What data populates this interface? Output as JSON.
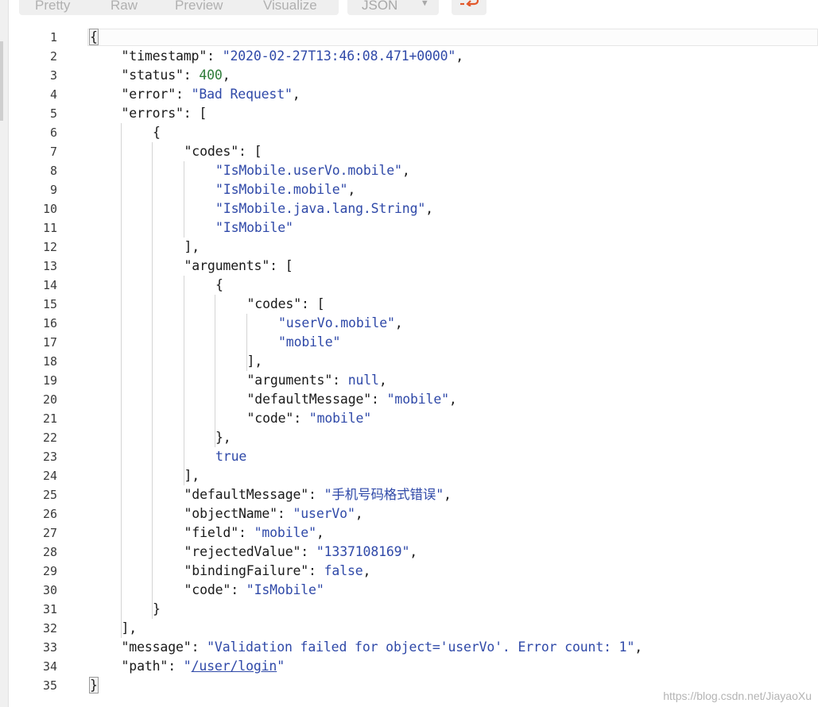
{
  "toolbar": {
    "tabs": [
      "Pretty",
      "Raw",
      "Preview",
      "Visualize"
    ],
    "format": "JSON",
    "icons": {
      "caret": "chevron-down-icon",
      "wrap": "line-wrap-icon"
    },
    "accent": "#e2582b"
  },
  "colors": {
    "string": "#2f49a8",
    "number": "#2f7d3a",
    "key": "#1a1a1a"
  },
  "editor": {
    "lines": [
      {
        "n": "1",
        "indent": 0,
        "tokens": [
          {
            "t": "{",
            "c": "p"
          }
        ]
      },
      {
        "n": "2",
        "indent": 1,
        "tokens": [
          {
            "t": "\"timestamp\"",
            "c": "k"
          },
          {
            "t": ": ",
            "c": "p"
          },
          {
            "t": "\"2020-02-27T13:46:08.471+0000\"",
            "c": "s"
          },
          {
            "t": ",",
            "c": "p"
          }
        ]
      },
      {
        "n": "3",
        "indent": 1,
        "tokens": [
          {
            "t": "\"status\"",
            "c": "k"
          },
          {
            "t": ": ",
            "c": "p"
          },
          {
            "t": "400",
            "c": "n"
          },
          {
            "t": ",",
            "c": "p"
          }
        ]
      },
      {
        "n": "4",
        "indent": 1,
        "tokens": [
          {
            "t": "\"error\"",
            "c": "k"
          },
          {
            "t": ": ",
            "c": "p"
          },
          {
            "t": "\"Bad Request\"",
            "c": "s"
          },
          {
            "t": ",",
            "c": "p"
          }
        ]
      },
      {
        "n": "5",
        "indent": 1,
        "tokens": [
          {
            "t": "\"errors\"",
            "c": "k"
          },
          {
            "t": ": [",
            "c": "p"
          }
        ]
      },
      {
        "n": "6",
        "indent": 2,
        "tokens": [
          {
            "t": "{",
            "c": "p"
          }
        ]
      },
      {
        "n": "7",
        "indent": 3,
        "tokens": [
          {
            "t": "\"codes\"",
            "c": "k"
          },
          {
            "t": ": [",
            "c": "p"
          }
        ]
      },
      {
        "n": "8",
        "indent": 4,
        "tokens": [
          {
            "t": "\"IsMobile.userVo.mobile\"",
            "c": "s"
          },
          {
            "t": ",",
            "c": "p"
          }
        ]
      },
      {
        "n": "9",
        "indent": 4,
        "tokens": [
          {
            "t": "\"IsMobile.mobile\"",
            "c": "s"
          },
          {
            "t": ",",
            "c": "p"
          }
        ]
      },
      {
        "n": "10",
        "indent": 4,
        "tokens": [
          {
            "t": "\"IsMobile.java.lang.String\"",
            "c": "s"
          },
          {
            "t": ",",
            "c": "p"
          }
        ]
      },
      {
        "n": "11",
        "indent": 4,
        "tokens": [
          {
            "t": "\"IsMobile\"",
            "c": "s"
          }
        ]
      },
      {
        "n": "12",
        "indent": 3,
        "tokens": [
          {
            "t": "],",
            "c": "p"
          }
        ]
      },
      {
        "n": "13",
        "indent": 3,
        "tokens": [
          {
            "t": "\"arguments\"",
            "c": "k"
          },
          {
            "t": ": [",
            "c": "p"
          }
        ]
      },
      {
        "n": "14",
        "indent": 4,
        "tokens": [
          {
            "t": "{",
            "c": "p"
          }
        ]
      },
      {
        "n": "15",
        "indent": 5,
        "tokens": [
          {
            "t": "\"codes\"",
            "c": "k"
          },
          {
            "t": ": [",
            "c": "p"
          }
        ]
      },
      {
        "n": "16",
        "indent": 6,
        "tokens": [
          {
            "t": "\"userVo.mobile\"",
            "c": "s"
          },
          {
            "t": ",",
            "c": "p"
          }
        ]
      },
      {
        "n": "17",
        "indent": 6,
        "tokens": [
          {
            "t": "\"mobile\"",
            "c": "s"
          }
        ]
      },
      {
        "n": "18",
        "indent": 5,
        "tokens": [
          {
            "t": "],",
            "c": "p"
          }
        ]
      },
      {
        "n": "19",
        "indent": 5,
        "tokens": [
          {
            "t": "\"arguments\"",
            "c": "k"
          },
          {
            "t": ": ",
            "c": "p"
          },
          {
            "t": "null",
            "c": "b"
          },
          {
            "t": ",",
            "c": "p"
          }
        ]
      },
      {
        "n": "20",
        "indent": 5,
        "tokens": [
          {
            "t": "\"defaultMessage\"",
            "c": "k"
          },
          {
            "t": ": ",
            "c": "p"
          },
          {
            "t": "\"mobile\"",
            "c": "s"
          },
          {
            "t": ",",
            "c": "p"
          }
        ]
      },
      {
        "n": "21",
        "indent": 5,
        "tokens": [
          {
            "t": "\"code\"",
            "c": "k"
          },
          {
            "t": ": ",
            "c": "p"
          },
          {
            "t": "\"mobile\"",
            "c": "s"
          }
        ]
      },
      {
        "n": "22",
        "indent": 4,
        "tokens": [
          {
            "t": "},",
            "c": "p"
          }
        ]
      },
      {
        "n": "23",
        "indent": 4,
        "tokens": [
          {
            "t": "true",
            "c": "b"
          }
        ]
      },
      {
        "n": "24",
        "indent": 3,
        "tokens": [
          {
            "t": "],",
            "c": "p"
          }
        ]
      },
      {
        "n": "25",
        "indent": 3,
        "tokens": [
          {
            "t": "\"defaultMessage\"",
            "c": "k"
          },
          {
            "t": ": ",
            "c": "p"
          },
          {
            "t": "\"手机号码格式错误\"",
            "c": "s"
          },
          {
            "t": ",",
            "c": "p"
          }
        ]
      },
      {
        "n": "26",
        "indent": 3,
        "tokens": [
          {
            "t": "\"objectName\"",
            "c": "k"
          },
          {
            "t": ": ",
            "c": "p"
          },
          {
            "t": "\"userVo\"",
            "c": "s"
          },
          {
            "t": ",",
            "c": "p"
          }
        ]
      },
      {
        "n": "27",
        "indent": 3,
        "tokens": [
          {
            "t": "\"field\"",
            "c": "k"
          },
          {
            "t": ": ",
            "c": "p"
          },
          {
            "t": "\"mobile\"",
            "c": "s"
          },
          {
            "t": ",",
            "c": "p"
          }
        ]
      },
      {
        "n": "28",
        "indent": 3,
        "tokens": [
          {
            "t": "\"rejectedValue\"",
            "c": "k"
          },
          {
            "t": ": ",
            "c": "p"
          },
          {
            "t": "\"1337108169\"",
            "c": "s"
          },
          {
            "t": ",",
            "c": "p"
          }
        ]
      },
      {
        "n": "29",
        "indent": 3,
        "tokens": [
          {
            "t": "\"bindingFailure\"",
            "c": "k"
          },
          {
            "t": ": ",
            "c": "p"
          },
          {
            "t": "false",
            "c": "b"
          },
          {
            "t": ",",
            "c": "p"
          }
        ]
      },
      {
        "n": "30",
        "indent": 3,
        "tokens": [
          {
            "t": "\"code\"",
            "c": "k"
          },
          {
            "t": ": ",
            "c": "p"
          },
          {
            "t": "\"IsMobile\"",
            "c": "s"
          }
        ]
      },
      {
        "n": "31",
        "indent": 2,
        "tokens": [
          {
            "t": "}",
            "c": "p"
          }
        ]
      },
      {
        "n": "32",
        "indent": 1,
        "tokens": [
          {
            "t": "],",
            "c": "p"
          }
        ]
      },
      {
        "n": "33",
        "indent": 1,
        "tokens": [
          {
            "t": "\"message\"",
            "c": "k"
          },
          {
            "t": ": ",
            "c": "p"
          },
          {
            "t": "\"Validation failed for object='userVo'. Error count: 1\"",
            "c": "s"
          },
          {
            "t": ",",
            "c": "p"
          }
        ]
      },
      {
        "n": "34",
        "indent": 1,
        "tokens": [
          {
            "t": "\"path\"",
            "c": "k"
          },
          {
            "t": ": ",
            "c": "p"
          },
          {
            "t": "\"",
            "c": "s"
          },
          {
            "t": "/user/login",
            "c": "lnk"
          },
          {
            "t": "\"",
            "c": "s"
          }
        ]
      },
      {
        "n": "35",
        "indent": 0,
        "tokens": [
          {
            "t": "}",
            "c": "p"
          }
        ]
      }
    ]
  },
  "watermark": "https://blog.csdn.net/JiayaoXu"
}
